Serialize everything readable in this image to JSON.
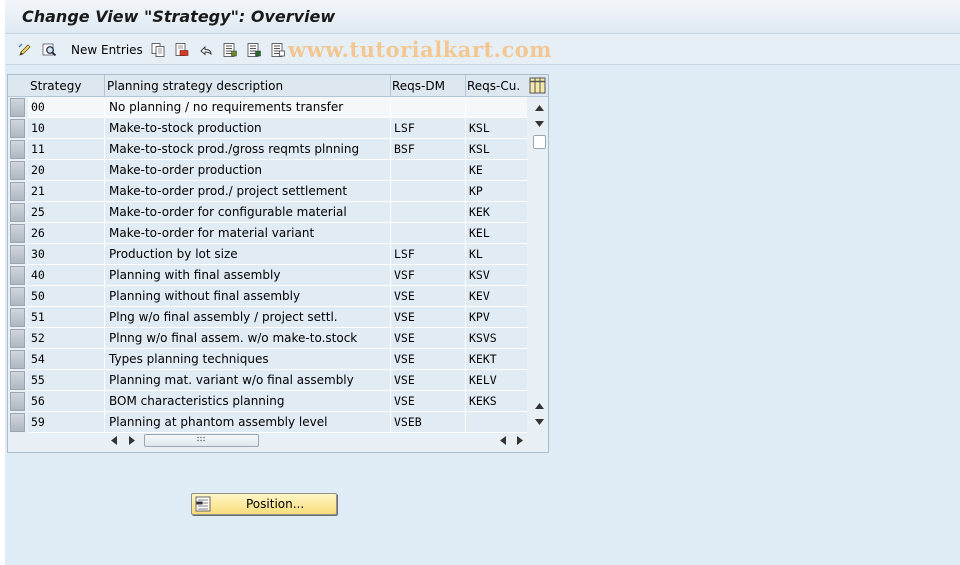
{
  "window": {
    "title": "Change View \"Strategy\": Overview"
  },
  "toolbar": {
    "new_entries_label": "New Entries",
    "icons": [
      "edit-icon",
      "display-icon",
      "copy-icon",
      "delete-icon",
      "undo-icon",
      "select-all-icon",
      "select-block-icon",
      "deselect-all-icon"
    ]
  },
  "watermark": "www.tutorialkart.com",
  "table": {
    "columns": [
      "Strategy",
      "Planning strategy description",
      "Reqs-DM",
      "Reqs-Cu."
    ],
    "rows": [
      {
        "strategy": "00",
        "description": "No planning / no requirements transfer",
        "reqs_dm": "",
        "reqs_cu": ""
      },
      {
        "strategy": "10",
        "description": "Make-to-stock production",
        "reqs_dm": "LSF",
        "reqs_cu": "KSL"
      },
      {
        "strategy": "11",
        "description": "Make-to-stock prod./gross reqmts plnning",
        "reqs_dm": "BSF",
        "reqs_cu": "KSL"
      },
      {
        "strategy": "20",
        "description": "Make-to-order production",
        "reqs_dm": "",
        "reqs_cu": "KE"
      },
      {
        "strategy": "21",
        "description": "Make-to-order prod./ project settlement",
        "reqs_dm": "",
        "reqs_cu": "KP"
      },
      {
        "strategy": "25",
        "description": "Make-to-order for configurable material",
        "reqs_dm": "",
        "reqs_cu": "KEK"
      },
      {
        "strategy": "26",
        "description": "Make-to-order for material variant",
        "reqs_dm": "",
        "reqs_cu": "KEL"
      },
      {
        "strategy": "30",
        "description": "Production by lot size",
        "reqs_dm": "LSF",
        "reqs_cu": "KL"
      },
      {
        "strategy": "40",
        "description": "Planning with final assembly",
        "reqs_dm": "VSF",
        "reqs_cu": "KSV"
      },
      {
        "strategy": "50",
        "description": "Planning without final assembly",
        "reqs_dm": "VSE",
        "reqs_cu": "KEV"
      },
      {
        "strategy": "51",
        "description": "Plng w/o final assembly / project settl.",
        "reqs_dm": "VSE",
        "reqs_cu": "KPV"
      },
      {
        "strategy": "52",
        "description": "Plnng w/o final assem. w/o make-to.stock",
        "reqs_dm": "VSE",
        "reqs_cu": "KSVS"
      },
      {
        "strategy": "54",
        "description": "Types planning techniques",
        "reqs_dm": "VSE",
        "reqs_cu": "KEKT"
      },
      {
        "strategy": "55",
        "description": "Planning mat. variant w/o final assembly",
        "reqs_dm": "VSE",
        "reqs_cu": "KELV"
      },
      {
        "strategy": "56",
        "description": "BOM characteristics planning",
        "reqs_dm": "VSE",
        "reqs_cu": "KEKS"
      },
      {
        "strategy": "59",
        "description": "Planning at phantom assembly level",
        "reqs_dm": "VSEB",
        "reqs_cu": ""
      }
    ]
  },
  "position_button": {
    "label": "Position..."
  }
}
